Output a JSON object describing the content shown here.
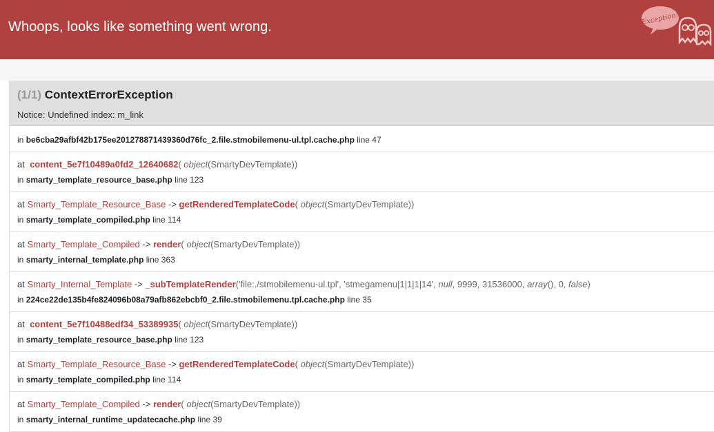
{
  "header": {
    "title": "Whoops, looks like something went wrong.",
    "mascot_text": "Exception!"
  },
  "exception": {
    "count": "(1/1)",
    "name": "ContextErrorException",
    "message": "Notice: Undefined index: m_link"
  },
  "first_location": {
    "in": "in",
    "file": "be6cba29afbf42b175ee201278871439360d76fc_2.file.stmobilemenu-ul.tpl.cache.php",
    "line_label": "line 47"
  },
  "frames": [
    {
      "at": "at",
      "class": "",
      "arrow": "",
      "func": "content_5e7f10489a0fd2_12640682",
      "args": [
        {
          "kw": "object",
          "val": "(SmartyDevTemplate)"
        }
      ],
      "file": "smarty_template_resource_base.php",
      "line_label": "line 123"
    },
    {
      "at": "at",
      "class": "Smarty_Template_Resource_Base",
      "arrow": "->",
      "func": "getRenderedTemplateCode",
      "args": [
        {
          "kw": "object",
          "val": "(SmartyDevTemplate)"
        }
      ],
      "file": "smarty_template_compiled.php",
      "line_label": "line 114"
    },
    {
      "at": "at",
      "class": "Smarty_Template_Compiled",
      "arrow": "->",
      "func": "render",
      "args": [
        {
          "kw": "object",
          "val": "(SmartyDevTemplate)"
        }
      ],
      "file": "smarty_internal_template.php",
      "line_label": "line 363"
    },
    {
      "at": "at",
      "class": "Smarty_Internal_Template",
      "arrow": "->",
      "func": "_subTemplateRender",
      "args_text": "'file:./stmobilemenu-ul.tpl', 'stmegamenu|1|1|1|14',",
      "args_null": "null",
      "args_mid": ", 9999, 31536000,",
      "args_array": "array",
      "args_tail": "(), 0,",
      "args_false": "false",
      "file": "224ce22de135b4fe824096b08a79afb862ebcbf0_2.file.stmobilemenu.tpl.cache.php",
      "line_label": "line 35"
    },
    {
      "at": "at",
      "class": "",
      "arrow": "",
      "func": "content_5e7f10488edf34_53389935",
      "args": [
        {
          "kw": "object",
          "val": "(SmartyDevTemplate)"
        }
      ],
      "file": "smarty_template_resource_base.php",
      "line_label": "line 123"
    },
    {
      "at": "at",
      "class": "Smarty_Template_Resource_Base",
      "arrow": "->",
      "func": "getRenderedTemplateCode",
      "args": [
        {
          "kw": "object",
          "val": "(SmartyDevTemplate)"
        }
      ],
      "file": "smarty_template_compiled.php",
      "line_label": "line 114"
    },
    {
      "at": "at",
      "class": "Smarty_Template_Compiled",
      "arrow": "->",
      "func": "render",
      "args": [
        {
          "kw": "object",
          "val": "(SmartyDevTemplate)"
        }
      ],
      "file": "smarty_internal_runtime_updatecache.php",
      "line_label": "line 39"
    }
  ],
  "colors": {
    "header_bg": "#b0413e",
    "accent": "#b0413e",
    "panel_bg": "#e0e0e0"
  },
  "in_label": "in"
}
